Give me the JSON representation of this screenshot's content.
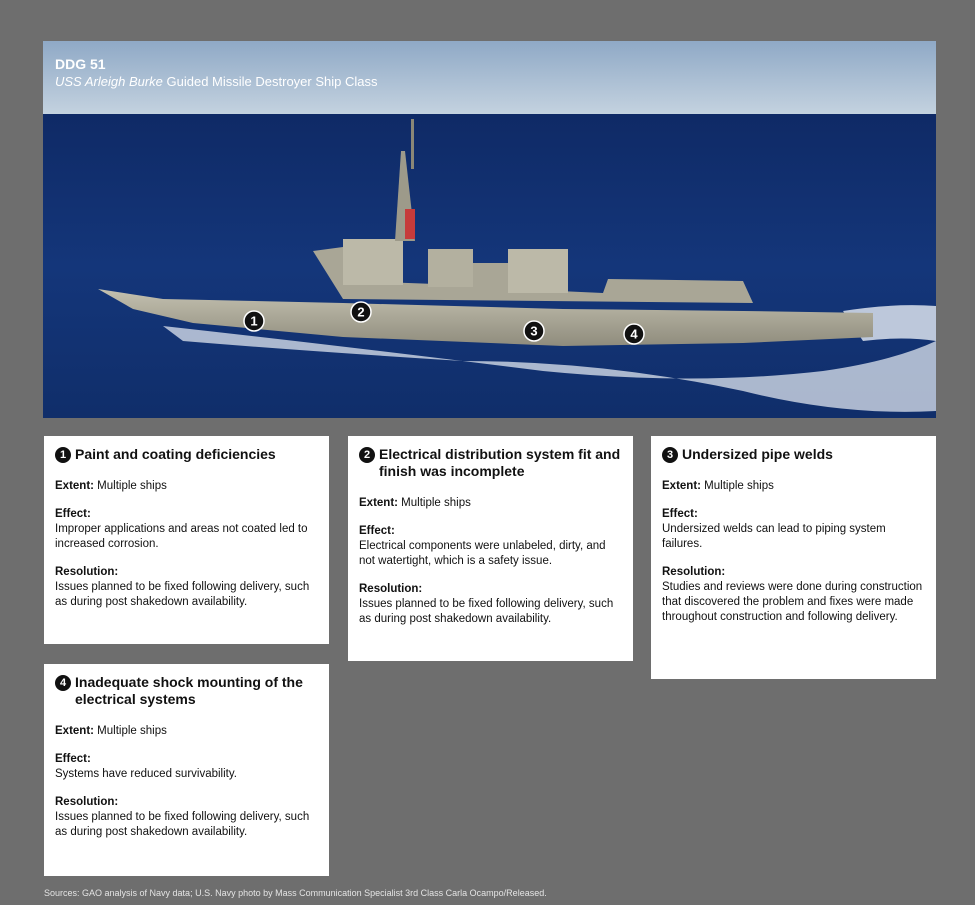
{
  "photo": {
    "code": "DDG 51",
    "class_italic": "USS Arleigh Burke",
    "class_rest": " Guided Missile Destroyer Ship Class",
    "markers": [
      "1",
      "2",
      "3",
      "4"
    ]
  },
  "cards": [
    {
      "number": "1",
      "title": "Paint and coating deficiencies",
      "extent_label": "Extent:",
      "extent": " Multiple ships",
      "effect_label": "Effect:",
      "effect": "Improper applications and areas not coated led to increased corrosion.",
      "resolution_label": "Resolution:",
      "resolution": "Issues planned to be fixed following delivery, such as during post shakedown availability."
    },
    {
      "number": "2",
      "title": "Electrical distribution system fit and finish was incomplete",
      "extent_label": "Extent:",
      "extent": " Multiple ships",
      "effect_label": "Effect:",
      "effect": "Electrical components were unlabeled, dirty, and not watertight, which is a safety issue.",
      "resolution_label": "Resolution:",
      "resolution": "Issues planned to be fixed following delivery, such as during post shakedown availability."
    },
    {
      "number": "3",
      "title": "Undersized pipe welds",
      "extent_label": "Extent:",
      "extent": " Multiple ships",
      "effect_label": "Effect:",
      "effect": "Undersized welds can lead to piping system failures.",
      "resolution_label": "Resolution:",
      "resolution": "Studies and reviews were done during construction that discovered the problem and fixes were made throughout construction and following delivery."
    },
    {
      "number": "4",
      "title": "Inadequate shock mounting of the electrical systems",
      "extent_label": "Extent:",
      "extent": " Multiple ships",
      "effect_label": "Effect:",
      "effect": "Systems have reduced survivability.",
      "resolution_label": "Resolution:",
      "resolution": "Issues planned to be fixed following delivery, such as during post shakedown availability."
    }
  ],
  "sources": "Sources: GAO analysis of Navy data; U.S. Navy photo by Mass Communication Specialist 3rd Class Carla Ocampo/Released.",
  "colors": {
    "background": "#6e6e6e",
    "sea": "#12316e",
    "sky": "#a9bfd6",
    "hull": "#b3b09f",
    "card": "#ffffff"
  }
}
